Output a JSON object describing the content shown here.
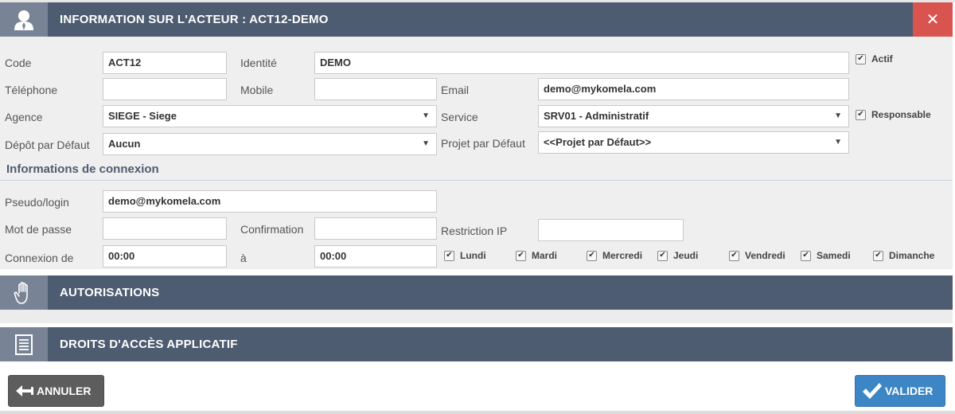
{
  "header": {
    "title": "INFORMATION SUR L'ACTEUR : ACT12-DEMO",
    "close_label": "✕"
  },
  "form": {
    "code": {
      "label": "Code",
      "value": "ACT12"
    },
    "identite": {
      "label": "Identité",
      "value": "DEMO"
    },
    "actif": {
      "label": "Actif",
      "checked": true
    },
    "telephone": {
      "label": "Téléphone",
      "value": ""
    },
    "mobile": {
      "label": "Mobile",
      "value": ""
    },
    "email": {
      "label": "Email",
      "value": "demo@mykomela.com"
    },
    "agence": {
      "label": "Agence",
      "value": "SIEGE - Siege"
    },
    "service": {
      "label": "Service",
      "value": "SRV01 - Administratif"
    },
    "responsable": {
      "label": "Responsable",
      "checked": true
    },
    "depot": {
      "label": "Dépôt par Défaut",
      "value": "Aucun"
    },
    "projet": {
      "label": "Projet par Défaut",
      "value": "<<Projet par Défaut>>"
    }
  },
  "connexion": {
    "section_title": "Informations de connexion",
    "login": {
      "label": "Pseudo/login",
      "value": "demo@mykomela.com"
    },
    "password": {
      "label": "Mot de passe",
      "value": ""
    },
    "confirmation": {
      "label": "Confirmation",
      "value": ""
    },
    "restriction_ip": {
      "label": "Restriction IP",
      "value": ""
    },
    "from": {
      "label": "Connexion de",
      "value": "00:00"
    },
    "to": {
      "label": "à",
      "value": "00:00"
    },
    "days": [
      {
        "label": "Lundi",
        "checked": true
      },
      {
        "label": "Mardi",
        "checked": true
      },
      {
        "label": "Mercredi",
        "checked": true
      },
      {
        "label": "Jeudi",
        "checked": true
      },
      {
        "label": "Vendredi",
        "checked": true
      },
      {
        "label": "Samedi",
        "checked": true
      },
      {
        "label": "Dimanche",
        "checked": true
      }
    ]
  },
  "sections": {
    "autorisations": "AUTORISATIONS",
    "droits": "DROITS D'ACCÈS APPLICATIF"
  },
  "footer": {
    "cancel_label": "ANNULER",
    "validate_label": "VALIDER"
  },
  "colors": {
    "header_bg": "#4d5c70",
    "icon_box_bg": "#788495",
    "close_bg": "#d9534f",
    "validate_bg": "#3d86c6",
    "cancel_bg": "#5d5d5d"
  },
  "icons": {
    "header": "user-icon",
    "close": "close-icon",
    "autorisations": "hand-icon",
    "droits": "document-icon",
    "cancel": "arrow-left-icon",
    "validate": "checkmark-icon"
  }
}
